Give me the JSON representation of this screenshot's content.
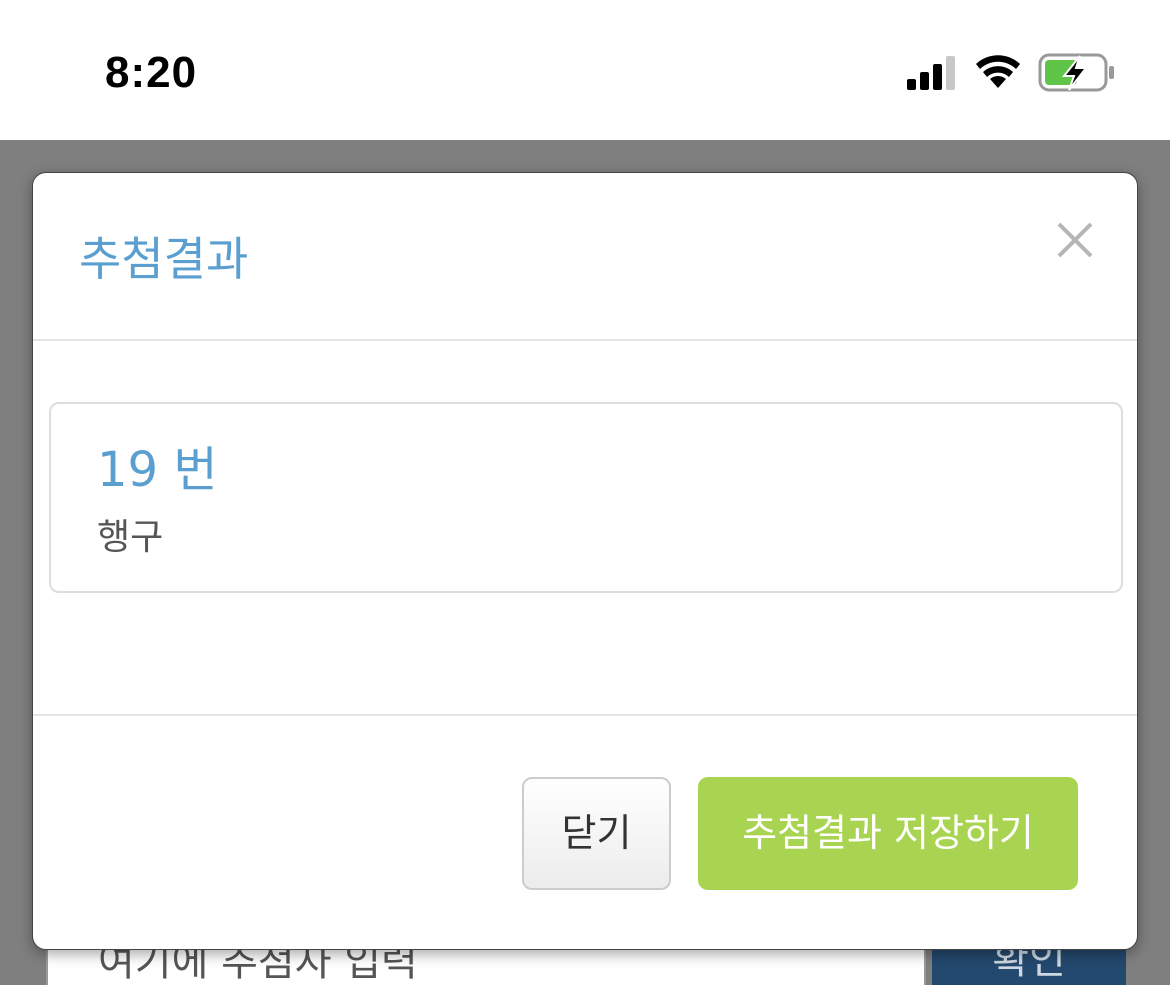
{
  "status_bar": {
    "time": "8:20",
    "icons": [
      "signal-icon",
      "wifi-icon",
      "battery-charging-icon"
    ],
    "battery_color": "#5fc447"
  },
  "background": {
    "input_placeholder": "여기에 추첨자 입력",
    "confirm_label": "확인"
  },
  "modal": {
    "title": "추첨결과",
    "close_icon": "close-icon",
    "result": {
      "number": "19 번",
      "name": "행구"
    },
    "buttons": {
      "close_label": "닫기",
      "save_label": "추첨결과 저장하기"
    }
  },
  "colors": {
    "title_blue": "#5a9fd0",
    "save_green": "#a9d451",
    "confirm_navy": "#24496f",
    "overlay_gray": "#7f7f7f"
  }
}
